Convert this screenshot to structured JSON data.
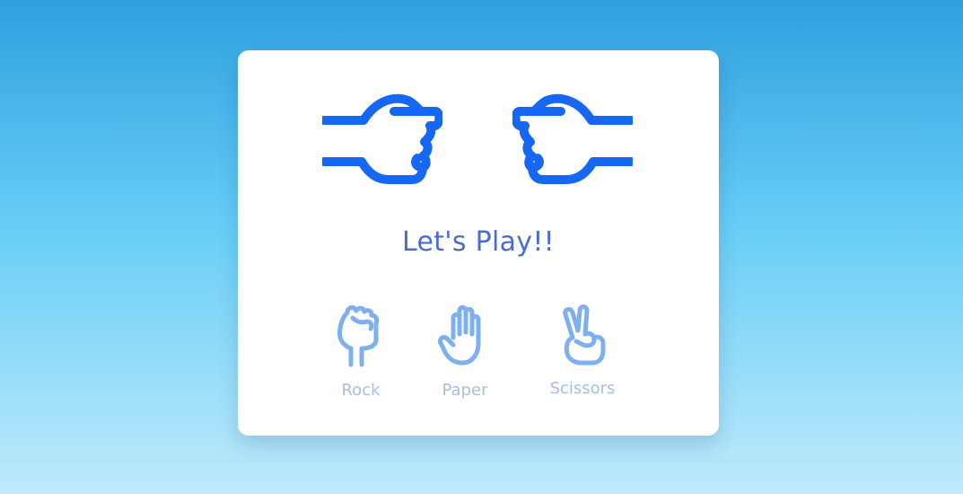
{
  "game": {
    "status_text": "Let's Play!!",
    "player_hand_icon": "rock-fist-pointing-right-icon",
    "computer_hand_icon": "rock-fist-pointing-left-icon"
  },
  "choices": [
    {
      "label": "Rock",
      "icon": "rock-hand-icon"
    },
    {
      "label": "Paper",
      "icon": "paper-hand-icon"
    },
    {
      "label": "Scissors",
      "icon": "scissors-hand-icon"
    }
  ],
  "colors": {
    "accent": "#1767f5",
    "title": "#4b6bd3",
    "choice_icon": "#7eb0f0",
    "choice_label": "#a9bde0",
    "card": "#ffffff"
  }
}
